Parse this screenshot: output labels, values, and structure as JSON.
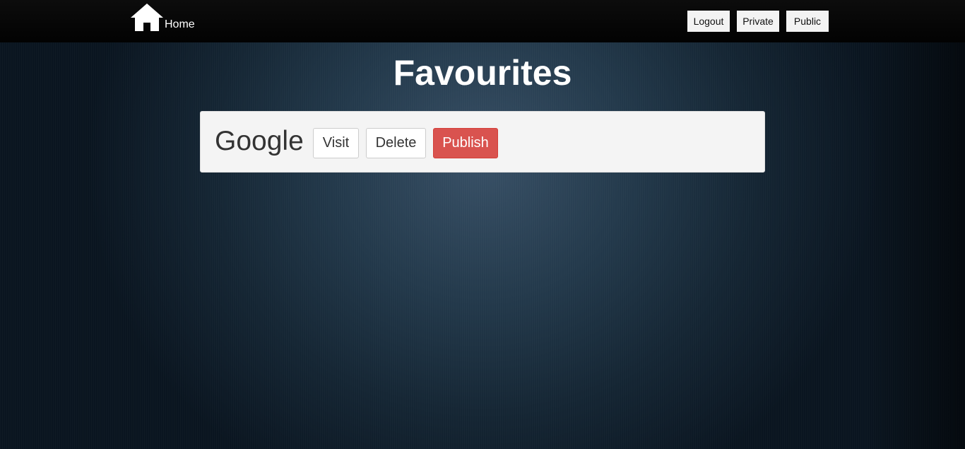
{
  "navbar": {
    "home_icon": "house-icon",
    "home_label": "Home",
    "buttons": {
      "logout": "Logout",
      "private": "Private",
      "public": "Public"
    }
  },
  "page": {
    "title": "Favourites"
  },
  "favourites": [
    {
      "name": "Google",
      "visit_label": "Visit",
      "delete_label": "Delete",
      "publish_label": "Publish"
    }
  ],
  "colors": {
    "publish_button": "#d9534f",
    "navbar": "#050505",
    "card_background": "#f4f4f4"
  }
}
